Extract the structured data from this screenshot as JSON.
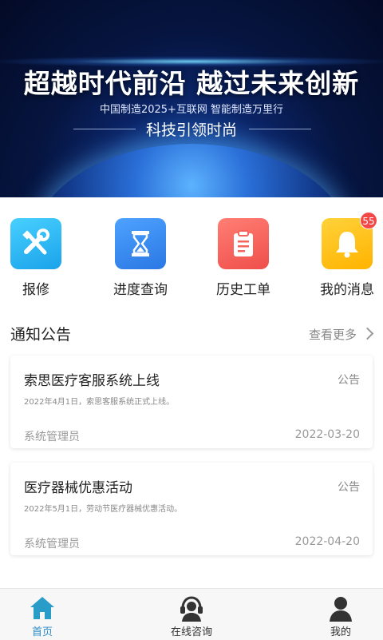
{
  "banner": {
    "headline": "超越时代前沿 越过未来创新",
    "subtitle": "中国制造2025+互联网 智能制造万里行",
    "slogan": "科技引领时尚"
  },
  "menu": [
    {
      "label": "报修",
      "icon": "tools-icon",
      "color": "#2fb4f2"
    },
    {
      "label": "进度查询",
      "icon": "hourglass-icon",
      "color": "#2f86f0"
    },
    {
      "label": "历史工单",
      "icon": "clipboard-icon",
      "color": "#f4655d"
    },
    {
      "label": "我的消息",
      "icon": "bell-icon",
      "color": "#ffbf14",
      "badge": "55"
    }
  ],
  "notices": {
    "title": "通知公告",
    "more": "查看更多",
    "items": [
      {
        "title": "索思医疗客服系统上线",
        "tag": "公告",
        "desc": "2022年4月1日，索思客服系统正式上线。",
        "author": "系统管理员",
        "date": "2022-03-20"
      },
      {
        "title": "医疗器械优惠活动",
        "tag": "公告",
        "desc": "2022年5月1日，劳动节医疗器械优惠活动。",
        "author": "系统管理员",
        "date": "2022-04-20"
      }
    ]
  },
  "tabbar": [
    {
      "label": "首页",
      "icon": "home-icon",
      "active": true
    },
    {
      "label": "在线咨询",
      "icon": "headset-icon",
      "active": false
    },
    {
      "label": "我的",
      "icon": "user-icon",
      "active": false
    }
  ],
  "colors": {
    "accent": "#2a8bc8",
    "badge": "#f24848"
  }
}
